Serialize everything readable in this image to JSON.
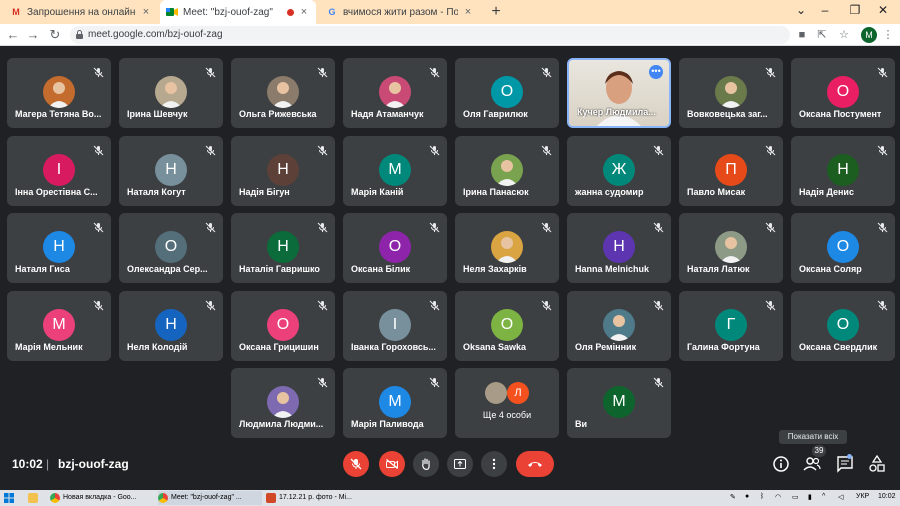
{
  "browser": {
    "tabs": [
      {
        "title": "Запрошення на онлайн-тренінг",
        "favicon": "gmail-icon"
      },
      {
        "title": "Meet: \"bzj-ouof-zag\"",
        "favicon": "meet-icon",
        "recording": true
      },
      {
        "title": "вчимося жити разом - Пошук G",
        "favicon": "google-icon"
      }
    ],
    "new_tab": "+",
    "url": "meet.google.com/bzj-ouof-zag",
    "profile_initial": "M"
  },
  "participants": [
    {
      "name": "Магера Тетяна Во...",
      "kind": "photo",
      "color": "#c46b2e"
    },
    {
      "name": "Ірина Шевчук",
      "kind": "photo",
      "color": "#b7a98f"
    },
    {
      "name": "Ольга Рижевська",
      "kind": "photo",
      "color": "#8a7b6a"
    },
    {
      "name": "Надя Атаманчук",
      "kind": "photo",
      "color": "#c94a74"
    },
    {
      "name": "Оля Гаврилюк",
      "initial": "О",
      "color": "#0097a7"
    },
    {
      "name": "Кучер Людмила...",
      "kind": "speaking"
    },
    {
      "name": "Вовковецька заг...",
      "kind": "photo",
      "color": "#6b7a4a"
    },
    {
      "name": "Оксана Постумент",
      "initial": "О",
      "color": "#e91e63"
    },
    {
      "name": "Інна Орестівна С...",
      "initial": "І",
      "color": "#d81b60"
    },
    {
      "name": "Наталя Когут",
      "initial": "Н",
      "color": "#78909c"
    },
    {
      "name": "Надія Бігун",
      "initial": "Н",
      "color": "#5d4037"
    },
    {
      "name": "Марія Каній",
      "initial": "М",
      "color": "#00897b"
    },
    {
      "name": "Ірина Панасюк",
      "kind": "photo",
      "color": "#7aa34f"
    },
    {
      "name": "жанна судомир",
      "initial": "Ж",
      "color": "#00897b"
    },
    {
      "name": "Павло Мисак",
      "initial": "П",
      "color": "#e64a19"
    },
    {
      "name": "Надія Денис",
      "initial": "Н",
      "color": "#1b5e20"
    },
    {
      "name": "Наталя Гиса",
      "initial": "Н",
      "color": "#1e88e5"
    },
    {
      "name": "Олександра Сер...",
      "initial": "О",
      "color": "#546e7a"
    },
    {
      "name": "Наталія Гавришко",
      "initial": "Н",
      "color": "#0b6b3a"
    },
    {
      "name": "Оксана Білик",
      "initial": "О",
      "color": "#8e24aa"
    },
    {
      "name": "Неля Захарків",
      "kind": "photo",
      "color": "#d9a441"
    },
    {
      "name": "Hanna Melnichuk",
      "initial": "H",
      "color": "#5e35b1"
    },
    {
      "name": "Наталя Латюк",
      "kind": "photo",
      "color": "#8d9a86"
    },
    {
      "name": "Оксана Соляр",
      "initial": "О",
      "color": "#1e88e5"
    },
    {
      "name": "Марія Мельник",
      "initial": "М",
      "color": "#ec407a"
    },
    {
      "name": "Неля Колодій",
      "initial": "Н",
      "color": "#1565c0"
    },
    {
      "name": "Оксана Грицишин",
      "initial": "О",
      "color": "#ec407a"
    },
    {
      "name": "Іванка Гороховсь...",
      "initial": "І",
      "color": "#78909c"
    },
    {
      "name": "Oksana Sawka",
      "initial": "O",
      "color": "#7cb342"
    },
    {
      "name": "Оля Ремінник",
      "kind": "photo",
      "color": "#4f7a8a"
    },
    {
      "name": "Галина Фортуна",
      "initial": "Г",
      "color": "#00897b"
    },
    {
      "name": "Оксана Свердлик",
      "initial": "О",
      "color": "#00897b"
    },
    {
      "name": "Людмила Людми...",
      "kind": "photo",
      "color": "#7e6ab0"
    },
    {
      "name": "Марія Паливода",
      "initial": "М",
      "color": "#1e88e5"
    },
    {
      "name": "",
      "kind": "more"
    },
    {
      "name": "Ви",
      "initial": "M",
      "color": "#0d652d"
    }
  ],
  "more_tile": {
    "label": "Ще 4 особи",
    "initial": "Л",
    "color": "#f4511e"
  },
  "speaking_initial": "",
  "toolbar": {
    "time": "10:02",
    "separator": "|",
    "meeting_code": "bzj-ouof-zag",
    "people_count": "39",
    "tooltip": "Показати всіх"
  },
  "taskbar": {
    "items": [
      {
        "label": "Новая вкладка - Goo..."
      },
      {
        "label": "Meet: \"bzj-ouof-zag\" ..."
      },
      {
        "label": "17.12.21 р. фото - Mi..."
      }
    ],
    "lang": "УКР",
    "time": "10:02"
  }
}
